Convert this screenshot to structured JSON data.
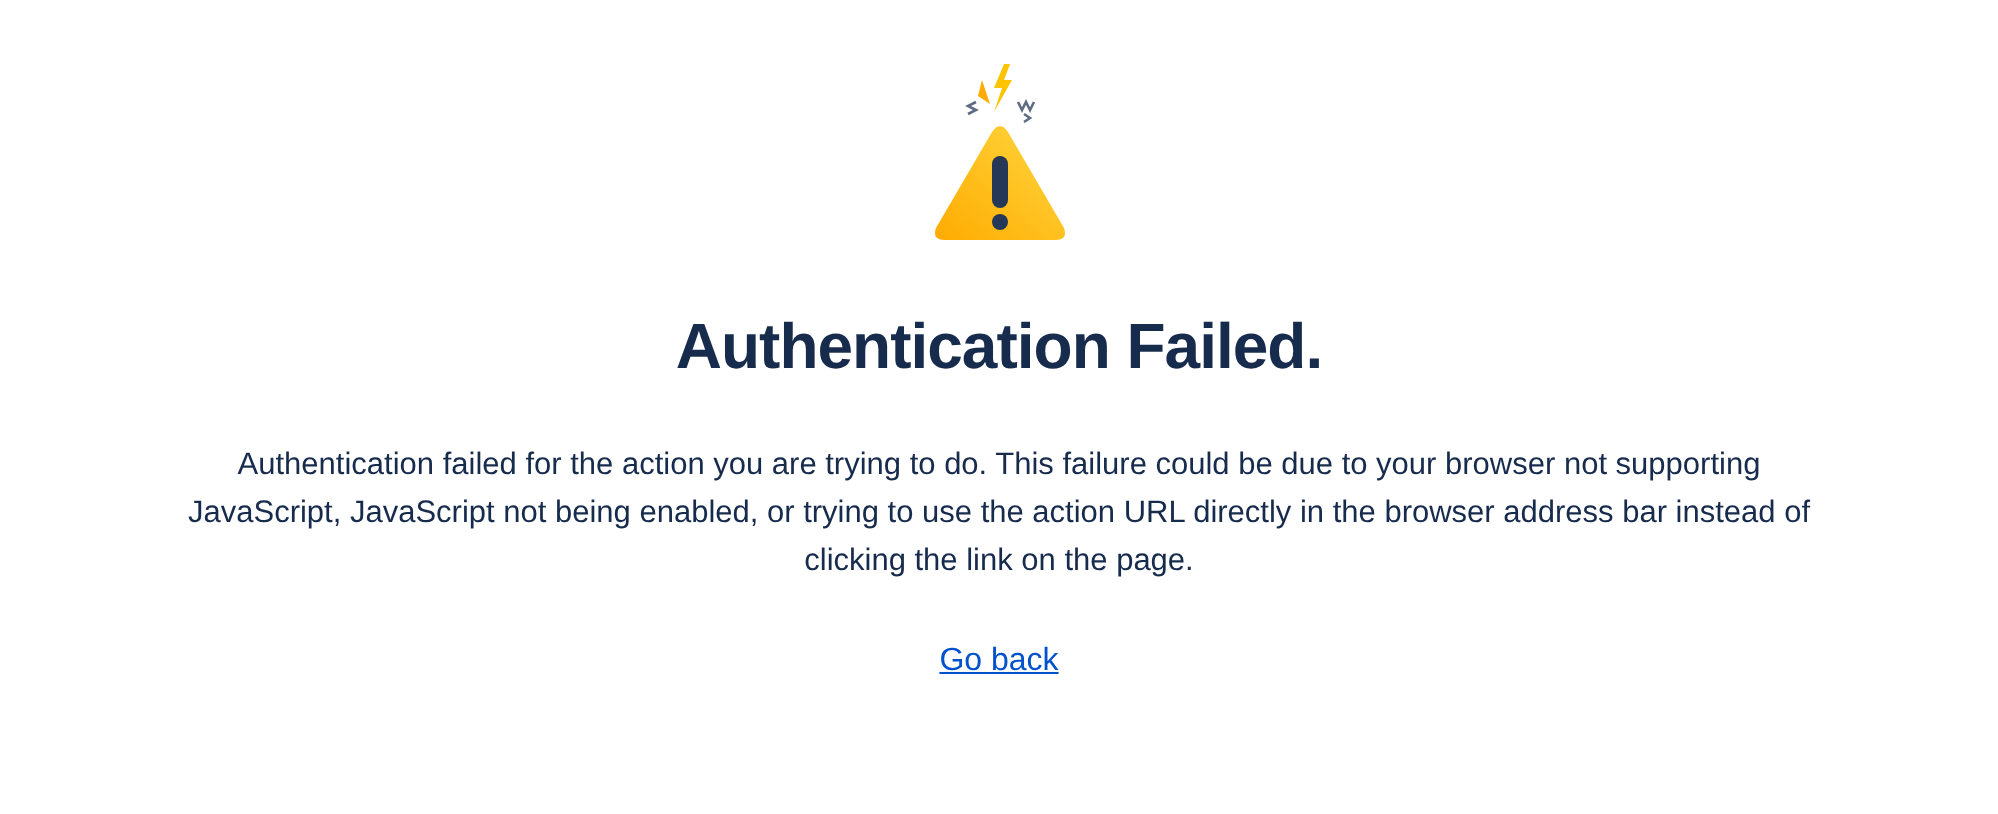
{
  "heading": "Authentication Failed.",
  "message": "Authentication failed for the action you are trying to do. This failure could be due to your browser not supporting JavaScript, JavaScript not being enabled, or trying to use the action URL directly in the browser address bar instead of clicking the link on the page.",
  "link": "Go back"
}
